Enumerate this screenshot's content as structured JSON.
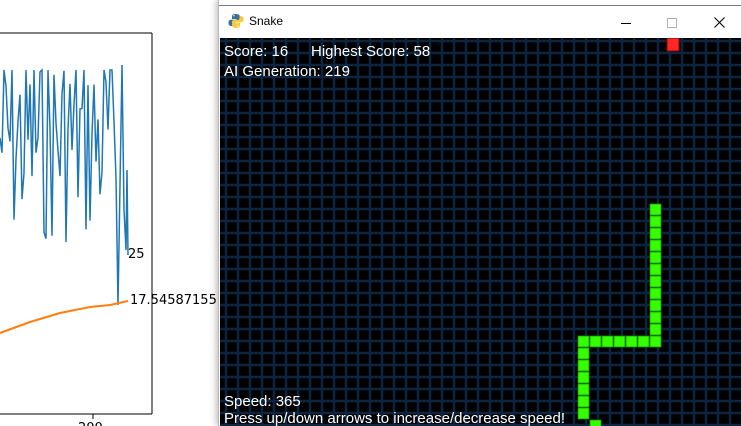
{
  "plot": {
    "label_score": "25",
    "label_mean": "17.54587155",
    "x_tick": "200",
    "colors": {
      "score_line": "#1f77b4",
      "mean_line": "#ff7f0e"
    }
  },
  "window": {
    "title": "Snake",
    "icon": "python-icon",
    "controls": [
      "minimize-icon",
      "maximize-icon",
      "close-icon"
    ]
  },
  "game": {
    "score_label": "Score: 16",
    "highest_label": "Highest Score: 58",
    "generation_label": "AI Generation: 219",
    "speed_label": "Speed: 365",
    "hint_label": "Press up/down arrows to increase/decrease speed!",
    "colors": {
      "grid": "#0d2540",
      "snake": "#33ff00",
      "food": "#ff2626",
      "background": "#000000"
    }
  }
}
